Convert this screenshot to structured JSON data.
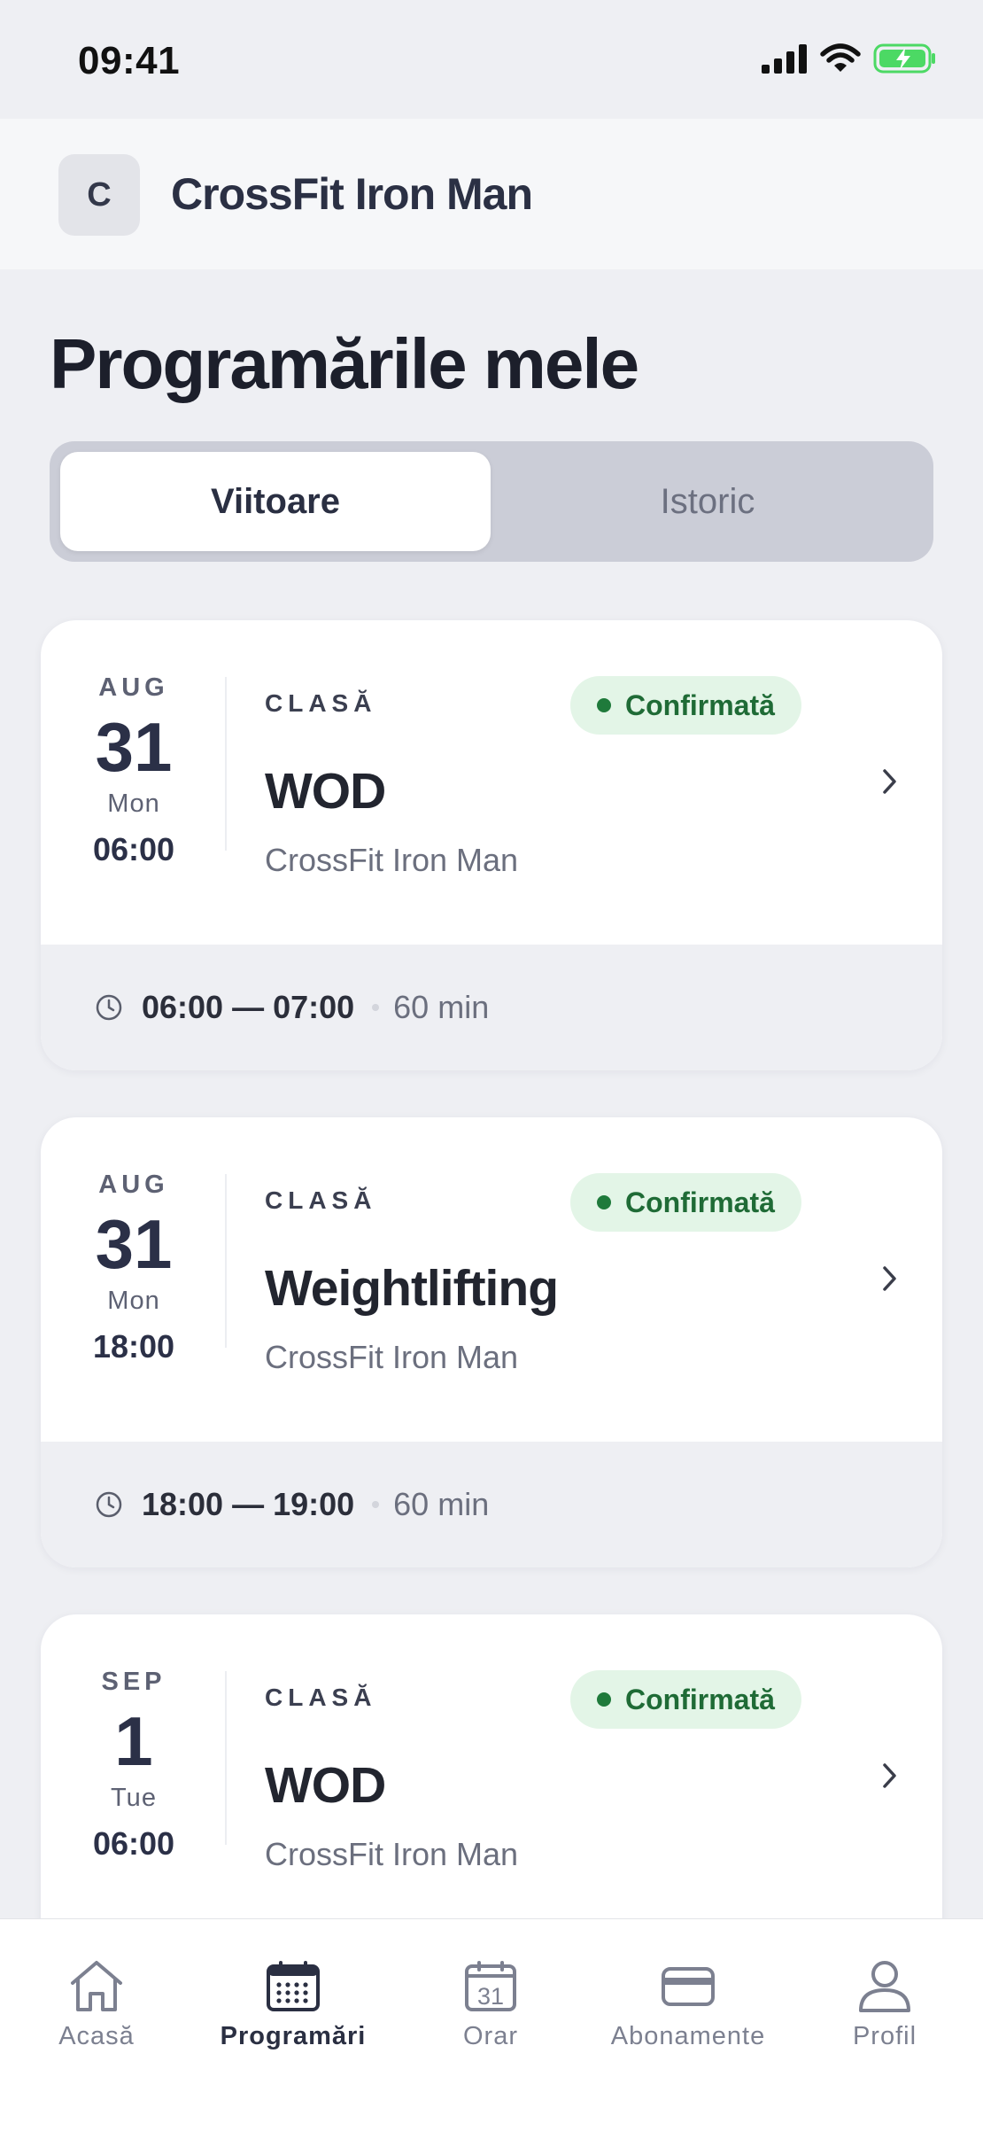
{
  "status_bar": {
    "time": "09:41"
  },
  "header": {
    "avatar_letter": "C",
    "gym_name": "CrossFit Iron Man"
  },
  "page": {
    "title": "Programările mele"
  },
  "tabs": [
    {
      "label": "Viitoare",
      "active": true
    },
    {
      "label": "Istoric",
      "active": false
    }
  ],
  "bookings": [
    {
      "month": "AUG",
      "day": "31",
      "weekday": "Mon",
      "start": "06:00",
      "type": "CLASĂ",
      "status": "Confirmată",
      "name": "WOD",
      "location": "CrossFit Iron Man",
      "time_range": "06:00 — 07:00",
      "duration": "60 min"
    },
    {
      "month": "AUG",
      "day": "31",
      "weekday": "Mon",
      "start": "18:00",
      "type": "CLASĂ",
      "status": "Confirmată",
      "name": "Weightlifting",
      "location": "CrossFit Iron Man",
      "time_range": "18:00 — 19:00",
      "duration": "60 min"
    },
    {
      "month": "SEP",
      "day": "1",
      "weekday": "Tue",
      "start": "06:00",
      "type": "CLASĂ",
      "status": "Confirmată",
      "name": "WOD",
      "location": "CrossFit Iron Man",
      "time_range": "",
      "duration": ""
    }
  ],
  "nav": [
    {
      "label": "Acasă",
      "icon": "home-icon",
      "active": false
    },
    {
      "label": "Programări",
      "icon": "calendar-grid-icon",
      "active": true
    },
    {
      "label": "Orar",
      "icon": "calendar-31-icon",
      "active": false
    },
    {
      "label": "Abonamente",
      "icon": "card-icon",
      "active": false
    },
    {
      "label": "Profil",
      "icon": "user-icon",
      "active": false
    }
  ],
  "colors": {
    "badge_bg": "#e3f5e7",
    "badge_text": "#1f6b36",
    "battery_green": "#4cd964",
    "primary_text": "#2b3047"
  }
}
